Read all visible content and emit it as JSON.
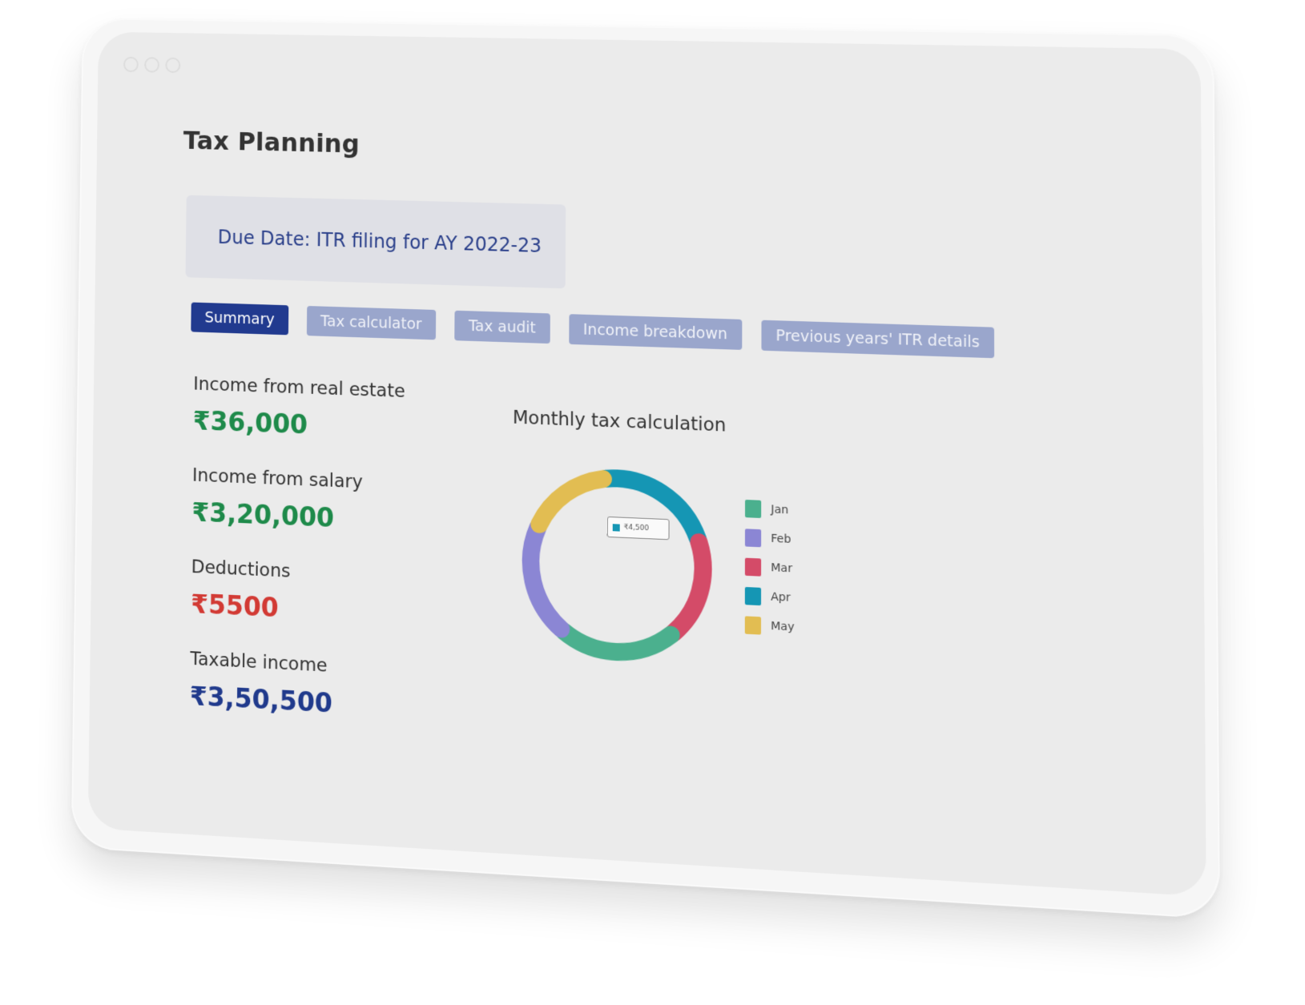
{
  "window": {
    "controls": [
      "circle",
      "circle",
      "circle"
    ]
  },
  "page": {
    "title": "Tax Planning"
  },
  "banner": {
    "text": "Due Date: ITR filing for AY 2022-23"
  },
  "tabs": [
    {
      "label": "Summary",
      "active": true
    },
    {
      "label": "Tax calculator",
      "active": false
    },
    {
      "label": "Tax audit",
      "active": false
    },
    {
      "label": "Income breakdown",
      "active": false
    },
    {
      "label": "Previous years' ITR details",
      "active": false
    }
  ],
  "stats": [
    {
      "label": "Income from real estate",
      "value": "₹36,000",
      "tone": "green"
    },
    {
      "label": "Income from salary",
      "value": "₹3,20,000",
      "tone": "green"
    },
    {
      "label": "Deductions",
      "value": "₹5500",
      "tone": "red"
    },
    {
      "label": "Taxable income",
      "value": "₹3,50,500",
      "tone": "blue"
    }
  ],
  "chart_title": "Monthly tax calculation",
  "tooltip": {
    "text": "₹4,500",
    "color": "#1596b4"
  },
  "chart_data": {
    "type": "pie",
    "title": "Monthly tax calculation",
    "categories": [
      "Jan",
      "Feb",
      "Mar",
      "Apr",
      "May"
    ],
    "values": [
      22,
      21,
      19,
      22,
      16
    ],
    "colors": [
      "#4bb08e",
      "#8b86d4",
      "#d44b68",
      "#1596b4",
      "#e2bd52"
    ],
    "legend": "right",
    "tooltip_value": "₹4,500"
  },
  "colors": {
    "primary": "#213a8f",
    "tab_inactive": "#9aa6cc",
    "green": "#1e8a4a",
    "red": "#d23a34",
    "blue": "#203a8c"
  }
}
